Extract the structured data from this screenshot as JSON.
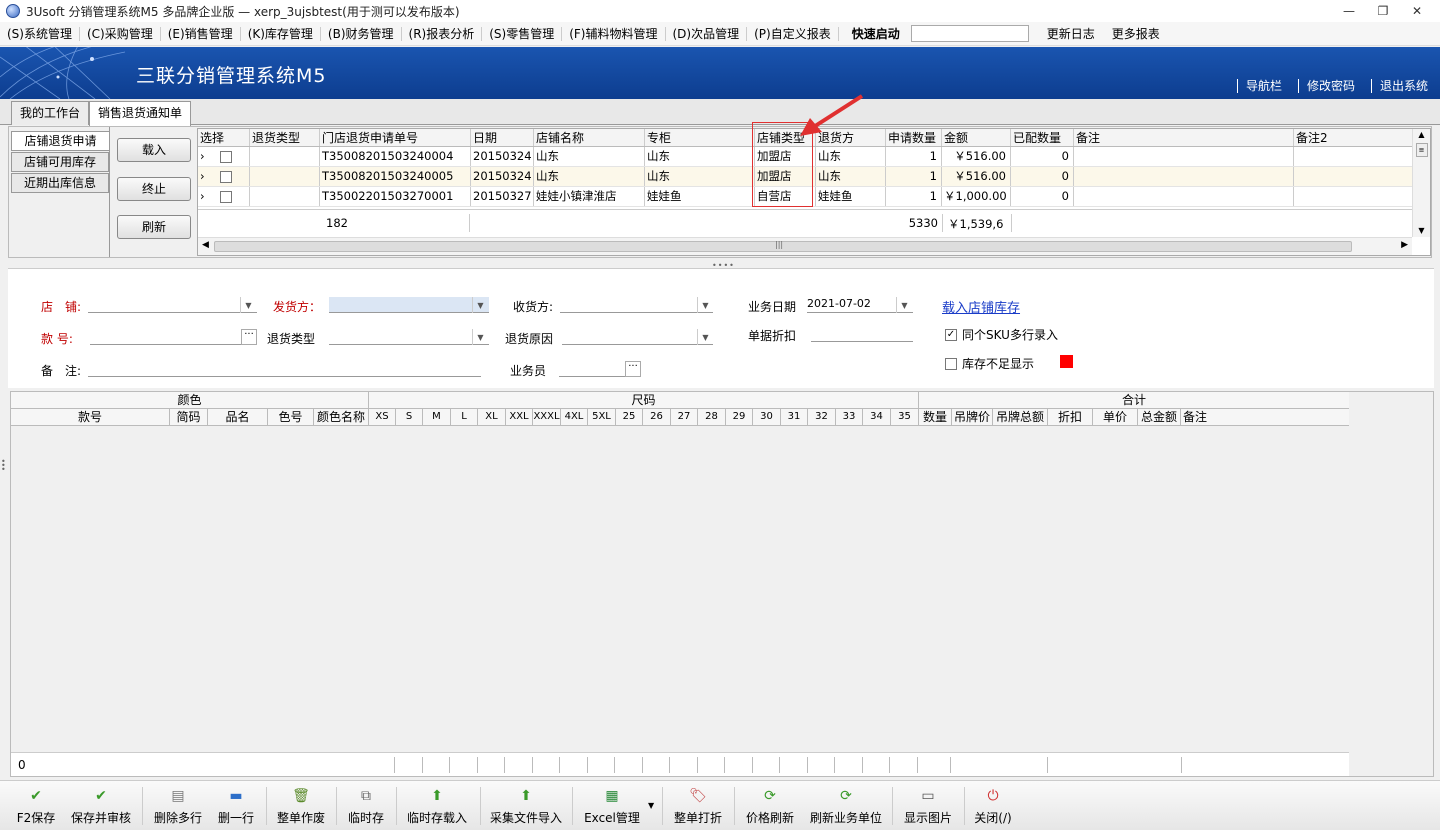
{
  "window": {
    "title": "3Usoft 分销管理系统M5 多品牌企业版 — xerp_3ujsbtest(用于测可以发布版本)",
    "min": "—",
    "restore": "❐",
    "close": "✕"
  },
  "menu": {
    "items": [
      "(S)系统管理",
      "(C)采购管理",
      "(E)销售管理",
      "(K)库存管理",
      "(B)财务管理",
      "(R)报表分析",
      "(S)零售管理",
      "(F)辅料物料管理",
      "(D)次品管理",
      "(P)自定义报表"
    ],
    "quick_label": "快速启动",
    "quick_value": "",
    "update_log": "更新日志",
    "more_reports": "更多报表"
  },
  "banner": {
    "brand": "三联分销管理系统M5",
    "links": [
      "导航栏",
      "修改密码",
      "退出系统"
    ]
  },
  "tabs": [
    "我的工作台",
    "销售退货通知单"
  ],
  "side_tabs": [
    "店铺退货申请",
    "店铺可用库存",
    "近期出库信息"
  ],
  "side_buttons": [
    "载入",
    "终止",
    "刷新"
  ],
  "grid": {
    "headers": [
      "选择",
      "退货类型",
      "门店退货申请单号",
      "日期",
      "店铺名称",
      "专柜",
      "店铺类型",
      "退货方",
      "申请数量",
      "金额",
      "已配数量",
      "备注",
      "备注2"
    ],
    "rows": [
      {
        "no": "T35008201503240004",
        "date": "20150324",
        "store": "山东",
        "counter": "山东",
        "store_type": "加盟店",
        "returner": "山东",
        "qty": "1",
        "amount": "￥516.00",
        "matched": "0"
      },
      {
        "no": "T35008201503240005",
        "date": "20150324",
        "store": "山东",
        "counter": "山东",
        "store_type": "加盟店",
        "returner": "山东",
        "qty": "1",
        "amount": "￥516.00",
        "matched": "0"
      },
      {
        "no": "T35002201503270001",
        "date": "20150327",
        "store": "娃娃小镇津淮店",
        "counter": "娃娃鱼",
        "store_type": "自营店",
        "returner": "娃娃鱼",
        "qty": "1",
        "amount": "￥1,000.00",
        "matched": "0"
      }
    ],
    "footer_count": "182",
    "footer_qty": "5330",
    "footer_amount": "￥1,539,6",
    "hscroll_grip": "|||"
  },
  "form": {
    "store_label": "店　铺:",
    "shipper_label": "发货方：",
    "receiver_label": "收货方:",
    "biz_date_label": "业务日期",
    "biz_date_value": "2021-07-02",
    "load_stock_link": "载入店铺库存",
    "style_label": "款 号:",
    "return_type_label": "退货类型",
    "return_reason_label": "退货原因",
    "discount_label": "单据折扣",
    "same_sku_label": "同个SKU多行录入",
    "same_sku_checked": true,
    "low_stock_label": "库存不足显示",
    "low_stock_checked": false,
    "low_stock_color": "#ff0000",
    "remark_label": "备　注:",
    "salesman_label": "业务员"
  },
  "lower": {
    "group_color": "颜色",
    "group_size": "尺码",
    "group_total": "合计",
    "cols_left": [
      "款号",
      "简码",
      "品名",
      "色号",
      "颜色名称"
    ],
    "cols_size": [
      "XS",
      "S",
      "M",
      "L",
      "XL",
      "XXL",
      "XXXL",
      "4XL",
      "5XL",
      "25",
      "26",
      "27",
      "28",
      "29",
      "30",
      "31",
      "32",
      "33",
      "34",
      "35"
    ],
    "cols_total": [
      "数量",
      "吊牌价",
      "吊牌总额",
      "折扣",
      "单价",
      "总金额",
      "备注"
    ],
    "footer_value": "0"
  },
  "toolbar": [
    "F2保存",
    "保存并审核",
    "删除多行",
    "删一行",
    "整单作废",
    "临时存",
    "临时存载入",
    "采集文件导入",
    "Excel管理",
    "整单打折",
    "价格刷新",
    "刷新业务单位",
    "显示图片",
    "关闭(/)"
  ]
}
